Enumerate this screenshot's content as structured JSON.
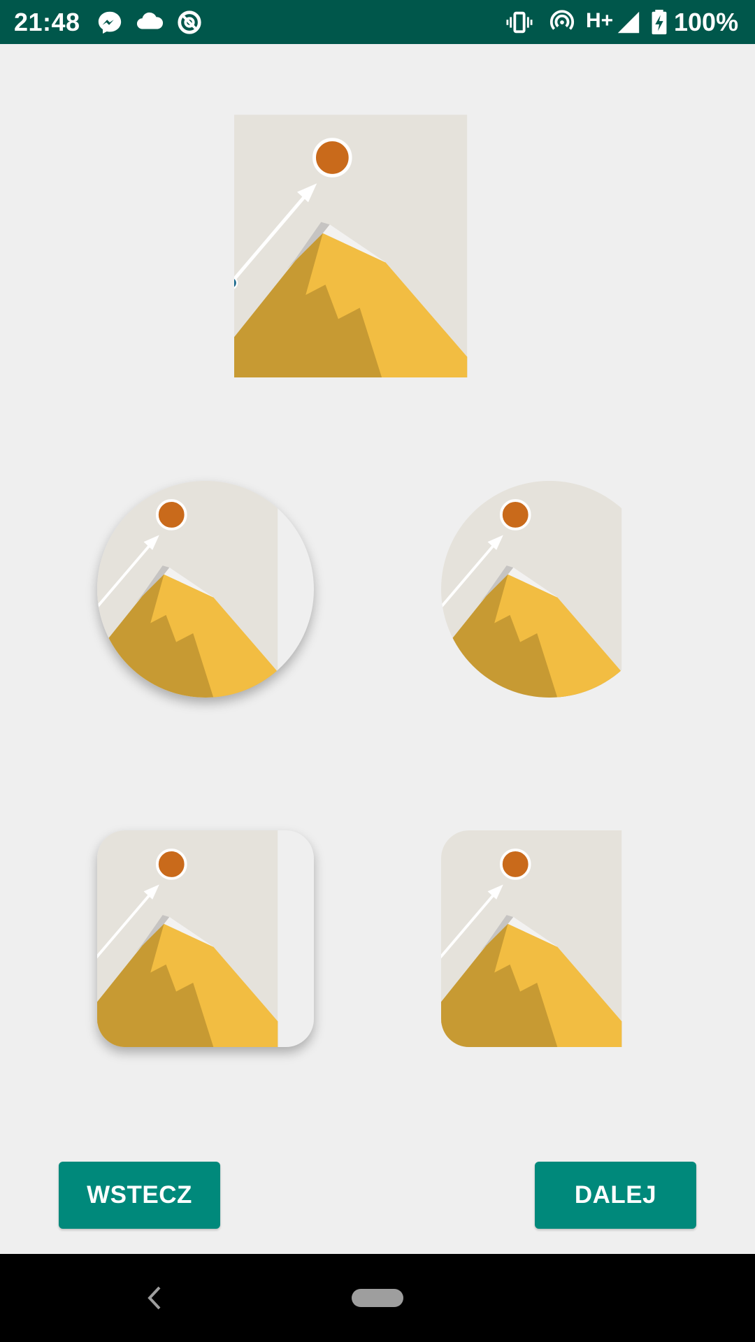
{
  "status_bar": {
    "time": "21:48",
    "network": "H+",
    "battery": "100%",
    "icons": [
      "messenger-icon",
      "cloud-icon",
      "sync-icon",
      "vibrate-icon",
      "hotspot-icon",
      "signal-icon",
      "battery-charging-icon"
    ]
  },
  "images": {
    "illustration": "mountain-peak-with-sun-and-arrow",
    "variants": [
      "square",
      "circle-with-shadow",
      "circle",
      "rounded-square-with-shadow",
      "rounded-square"
    ]
  },
  "buttons": {
    "back_label": "WSTECZ",
    "next_label": "DALEJ"
  },
  "colors": {
    "status_bar": "#00574b",
    "button": "#00897b",
    "background": "#efefef"
  },
  "nav_bar": {
    "icons": [
      "back-icon",
      "home-pill-icon"
    ]
  }
}
